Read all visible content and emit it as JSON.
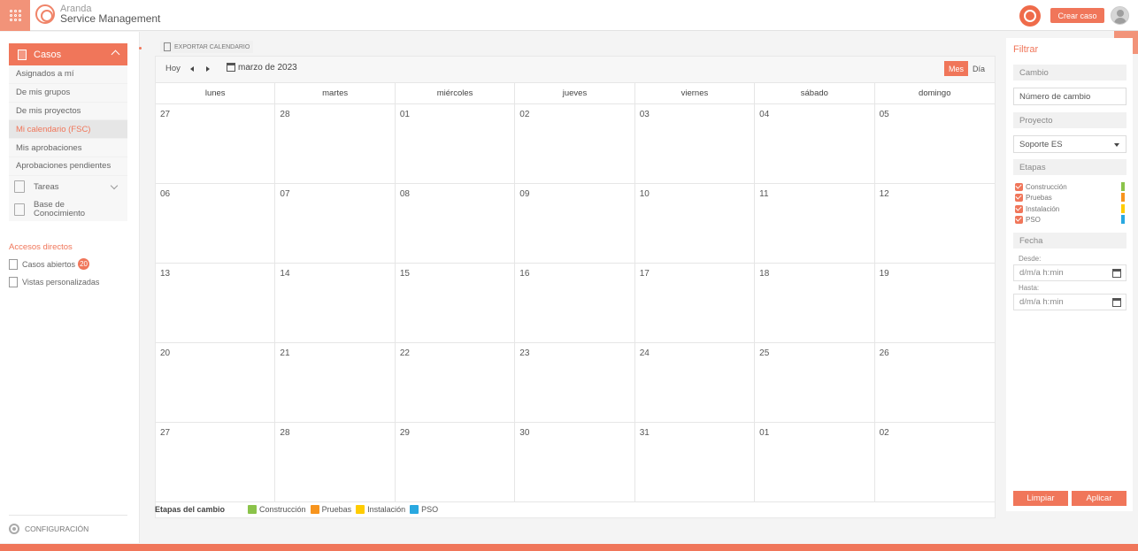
{
  "app": {
    "brand_line1": "Aranda",
    "brand_line2": "Service Management",
    "create_case_label": "Crear caso"
  },
  "sidebar": {
    "section_label": "Casos",
    "items": [
      {
        "label": "Asignados a mí"
      },
      {
        "label": "De mis grupos"
      },
      {
        "label": "De mis proyectos"
      },
      {
        "label": "Mi calendario (FSC)"
      },
      {
        "label": "Mis aprobaciones"
      },
      {
        "label": "Aprobaciones pendientes"
      }
    ],
    "groups": [
      {
        "label": "Tareas"
      },
      {
        "label_line1": "Base de",
        "label_line2": "Conocimiento"
      }
    ],
    "shortcuts_title": "Accesos directos",
    "shortcuts": [
      {
        "label": "Casos abiertos",
        "badge": "20"
      },
      {
        "label": "Vistas personalizadas"
      }
    ],
    "config_label": "CONFIGURACIÓN"
  },
  "calendar": {
    "export_label": "EXPORTAR CALENDARIO",
    "today_label": "Hoy",
    "month_label": "marzo de 2023",
    "view_month": "Mes",
    "view_day": "Día",
    "weekdays": [
      "lunes",
      "martes",
      "miércoles",
      "jueves",
      "viernes",
      "sábado",
      "domingo"
    ],
    "weeks": [
      [
        "27",
        "28",
        "01",
        "02",
        "03",
        "04",
        "05"
      ],
      [
        "06",
        "07",
        "08",
        "09",
        "10",
        "11",
        "12"
      ],
      [
        "13",
        "14",
        "15",
        "16",
        "17",
        "18",
        "19"
      ],
      [
        "20",
        "21",
        "22",
        "23",
        "24",
        "25",
        "26"
      ],
      [
        "27",
        "28",
        "29",
        "30",
        "31",
        "01",
        "02"
      ]
    ],
    "legend_title": "Etapas del cambio",
    "legend": [
      {
        "label": "Construcción",
        "color": "#8bc34a"
      },
      {
        "label": "Pruebas",
        "color": "#f7941d"
      },
      {
        "label": "Instalación",
        "color": "#ffcc00"
      },
      {
        "label": "PSO",
        "color": "#29a8e0"
      }
    ]
  },
  "filter": {
    "title": "Filtrar",
    "change_section": "Cambio",
    "change_number_value": "Número de cambio",
    "project_section": "Proyecto",
    "project_value": "Soporte ES",
    "stages_section": "Etapas",
    "stages": [
      {
        "label": "Construcción",
        "color": "#8bc34a",
        "checked": true
      },
      {
        "label": "Pruebas",
        "color": "#f7941d",
        "checked": true
      },
      {
        "label": "Instalación",
        "color": "#ffcc00",
        "checked": true
      },
      {
        "label": "PSO",
        "color": "#29a8e0",
        "checked": true
      }
    ],
    "date_section": "Fecha",
    "from_label": "Desde:",
    "from_placeholder": "d/m/a h:min",
    "to_label": "Hasta:",
    "to_placeholder": "d/m/a h:min",
    "clear_label": "Limpiar",
    "apply_label": "Aplicar"
  },
  "colors": {
    "accent": "#f0765a",
    "accent_light": "#f29379"
  }
}
